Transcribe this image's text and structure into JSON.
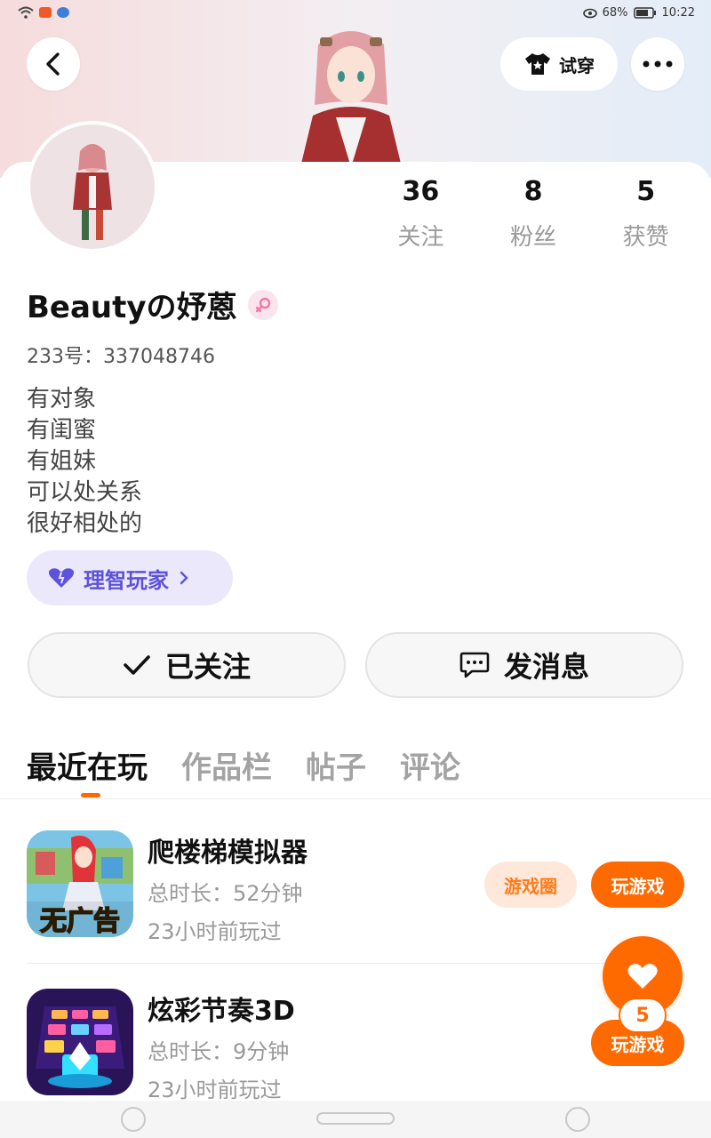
{
  "status_bar": {
    "battery": "68%",
    "time": "10:22"
  },
  "header": {
    "tryon_label": "试穿"
  },
  "profile": {
    "username": "Beautyの妤蒽",
    "uid": "233号：337048746",
    "bio": [
      "有对象",
      "有闺蜜",
      "有姐妹",
      "可以处关系",
      "很好相处的"
    ],
    "tag": "理智玩家"
  },
  "stats": [
    {
      "value": "36",
      "label": "关注"
    },
    {
      "value": "8",
      "label": "粉丝"
    },
    {
      "value": "5",
      "label": "获赞"
    }
  ],
  "actions": {
    "follow_label": "已关注",
    "message_label": "发消息"
  },
  "tabs": [
    "最近在玩",
    "作品栏",
    "帖子",
    "评论"
  ],
  "games": [
    {
      "title": "爬楼梯模拟器",
      "duration": "总时长：52分钟",
      "last_played": "23小时前玩过",
      "icon_text": "无广告",
      "circle_label": "游戏圈",
      "play_label": "玩游戏"
    },
    {
      "title": "炫彩节奏3D",
      "duration": "总时长：9分钟",
      "last_played": "23小时前玩过",
      "play_label": "玩游戏"
    }
  ],
  "like_fab": {
    "count": "5"
  },
  "colors": {
    "accent": "#ff6a00",
    "tag_text": "#5d52d9",
    "tag_bg": "#ebe8fb"
  }
}
